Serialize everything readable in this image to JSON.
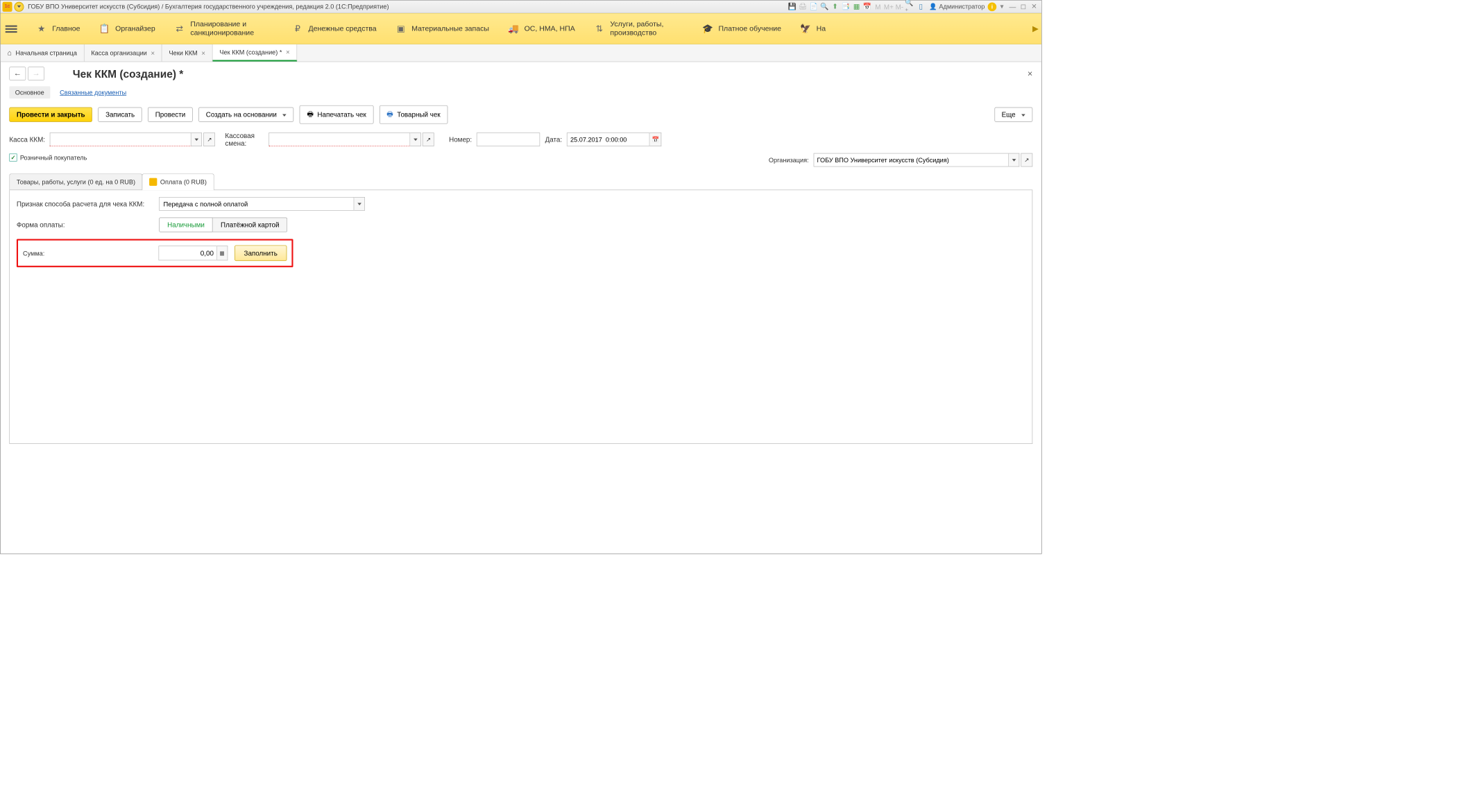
{
  "titleBar": {
    "title": "ГОБУ ВПО Университет искусств (Субсидия) / Бухгалтерия государственного учреждения, редакция 2.0  (1С:Предприятие)",
    "userLabel": "Администратор",
    "mText": "M",
    "mPlus": "M+",
    "mMinus": "M-"
  },
  "mainNav": {
    "items": [
      {
        "label": "Главное"
      },
      {
        "label": "Органайзер"
      },
      {
        "label": "Планирование и санкционирование"
      },
      {
        "label": "Денежные средства"
      },
      {
        "label": "Материальные запасы"
      },
      {
        "label": "ОС, НМА, НПА"
      },
      {
        "label": "Услуги, работы, производство"
      },
      {
        "label": "Платное обучение"
      },
      {
        "label": "На"
      }
    ]
  },
  "tabs": {
    "home": "Начальная страница",
    "t1": "Касса организации",
    "t2": "Чеки ККМ",
    "t3": "Чек ККМ (создание) *"
  },
  "page": {
    "title": "Чек ККМ (создание) *",
    "subMain": "Основное",
    "subLinked": "Связанные документы"
  },
  "actions": {
    "postClose": "Провести и закрыть",
    "save": "Записать",
    "post": "Провести",
    "createBased": "Создать на основании",
    "printReceipt": "Напечатать чек",
    "goodsReceipt": "Товарный чек",
    "more": "Еще"
  },
  "form": {
    "kassaLabel": "Касса ККМ:",
    "kassaValue": "",
    "shiftLabel": "Кассовая смена:",
    "shiftValue": "",
    "numberLabel": "Номер:",
    "numberValue": "",
    "dateLabel": "Дата:",
    "dateValue": "25.07.2017  0:00:00",
    "retailLabel": "Розничный покупатель",
    "orgLabel": "Организация:",
    "orgValue": "ГОБУ ВПО Университет искусств (Субсидия)"
  },
  "innerTabs": {
    "goods": "Товары, работы, услуги (0 ед. на 0 RUB)",
    "payment": "Оплата (0 RUB)"
  },
  "payment": {
    "methodLabel": "Признак способа расчета для чека ККМ:",
    "methodValue": "Передача с полной оплатой",
    "formLabel": "Форма оплаты:",
    "cash": "Наличными",
    "card": "Платёжной картой",
    "sumLabel": "Сумма:",
    "sumValue": "0,00",
    "fill": "Заполнить"
  }
}
